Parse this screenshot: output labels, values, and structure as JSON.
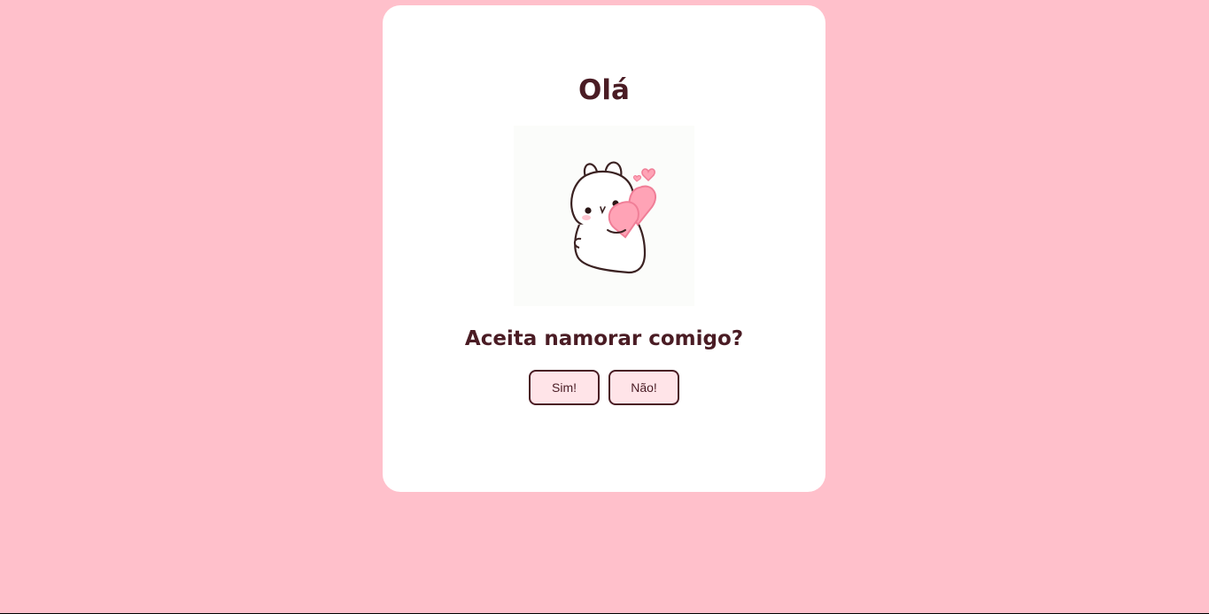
{
  "card": {
    "title": "Olá",
    "question": "Aceita namorar comigo?",
    "illustration": "bunny-holding-heart-icon"
  },
  "buttons": {
    "yes_label": "Sim!",
    "no_label": "Não!"
  },
  "colors": {
    "background": "#ffc0cb",
    "card": "#ffffff",
    "text": "#4a1c24",
    "button_fill": "#ffe4e8",
    "heart": "#ffa3b6"
  }
}
